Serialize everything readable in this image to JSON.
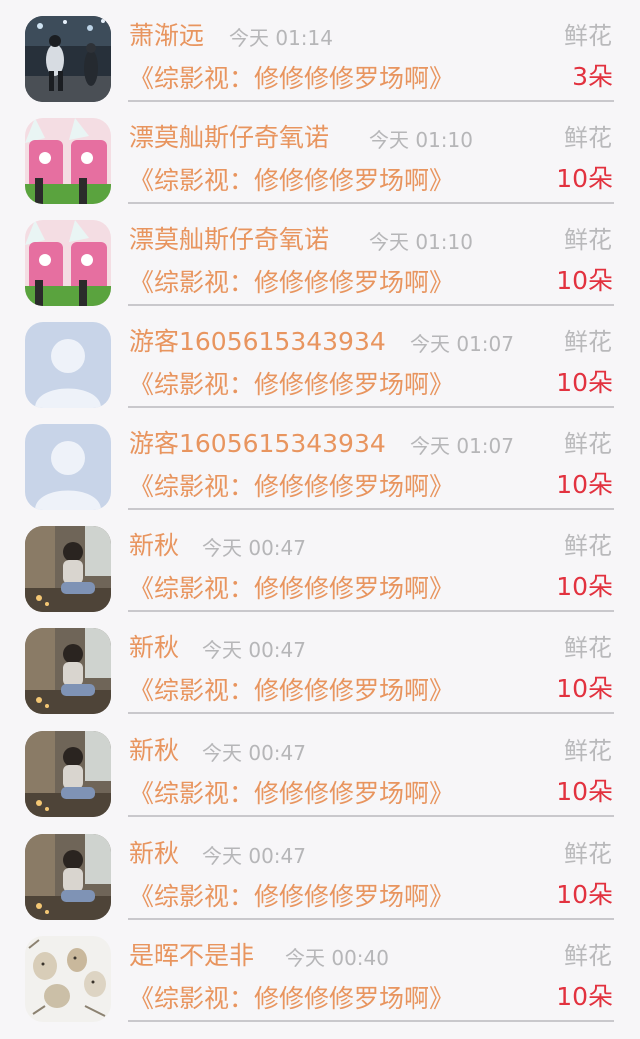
{
  "list": {
    "items": [
      {
        "user": "萧渐远",
        "time": "今天 01:14",
        "gift_type": "鲜花",
        "book_title": "《综影视：修修修修罗场啊》",
        "gift_count": "3朵",
        "avatar": "avatar-photo-dancer"
      },
      {
        "user": "漂莫舢斯仔奇氧诺",
        "time": "今天 01:10",
        "gift_type": "鲜花",
        "book_title": "《综影视：修修修修罗场啊》",
        "gift_count": "10朵",
        "avatar": "avatar-anime-pink"
      },
      {
        "user": "漂莫舢斯仔奇氧诺",
        "time": "今天 01:10",
        "gift_type": "鲜花",
        "book_title": "《综影视：修修修修罗场啊》",
        "gift_count": "10朵",
        "avatar": "avatar-anime-pink"
      },
      {
        "user": "游客1605615343934",
        "time": "今天 01:07",
        "gift_type": "鲜花",
        "book_title": "《综影视：修修修修罗场啊》",
        "gift_count": "10朵",
        "avatar": "avatar-default-person"
      },
      {
        "user": "游客1605615343934",
        "time": "今天 01:07",
        "gift_type": "鲜花",
        "book_title": "《综影视：修修修修罗场啊》",
        "gift_count": "10朵",
        "avatar": "avatar-default-person"
      },
      {
        "user": "新秋",
        "time": "今天 00:47",
        "gift_type": "鲜花",
        "book_title": "《综影视：修修修修罗场啊》",
        "gift_count": "10朵",
        "avatar": "avatar-photo-girl"
      },
      {
        "user": "新秋",
        "time": "今天 00:47",
        "gift_type": "鲜花",
        "book_title": "《综影视：修修修修罗场啊》",
        "gift_count": "10朵",
        "avatar": "avatar-photo-girl"
      },
      {
        "user": "新秋",
        "time": "今天 00:47",
        "gift_type": "鲜花",
        "book_title": "《综影视：修修修修罗场啊》",
        "gift_count": "10朵",
        "avatar": "avatar-photo-girl"
      },
      {
        "user": "新秋",
        "time": "今天 00:47",
        "gift_type": "鲜花",
        "book_title": "《综影视：修修修修罗场啊》",
        "gift_count": "10朵",
        "avatar": "avatar-photo-girl"
      },
      {
        "user": "是晖不是非",
        "time": "今天 00:40",
        "gift_type": "鲜花",
        "book_title": "《综影视：修修修修罗场啊》",
        "gift_count": "10朵",
        "avatar": "avatar-sketch-cats"
      }
    ]
  },
  "colors": {
    "accent_orange": "#e8955f",
    "count_red": "#e2323f",
    "muted_gray": "#b6b6b8",
    "background": "#f7f6f8"
  }
}
